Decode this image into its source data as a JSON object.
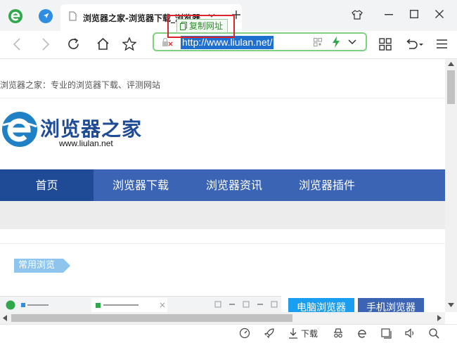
{
  "tab": {
    "title": "浏览器之家-浏览器下载_浏览器",
    "copy_tooltip": "复制网址"
  },
  "address_bar": {
    "url": "http://www.liulan.net/"
  },
  "site": {
    "tagline": "浏览器之家：专业的浏览器下载、评测网站",
    "logo_text": "浏览器之家",
    "logo_domain": "www.liulan.net",
    "nav": [
      "首页",
      "浏览器下载",
      "浏览器资讯",
      "浏览器插件"
    ],
    "section_tag": "常用浏览",
    "btn_pc": "电脑浏览器",
    "btn_mobile": "手机浏览器"
  },
  "status_bar": {
    "download_label": "下载"
  },
  "colors": {
    "accent_green": "#2ea84a",
    "nav_blue": "#3b65b4",
    "nav_active": "#1e4a96",
    "highlight_red": "#d9262c"
  }
}
